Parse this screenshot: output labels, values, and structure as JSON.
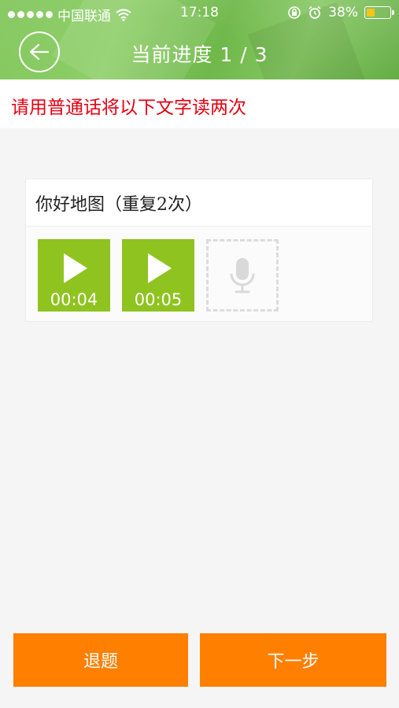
{
  "status_bar": {
    "carrier": "中国联通",
    "time": "17:18",
    "battery": "38%",
    "battery_level": 0.38
  },
  "header": {
    "back_icon": "back-arrow-icon",
    "title": "当前进度  1 / 3"
  },
  "instruction": "请用普通话将以下文字读两次",
  "card": {
    "prompt": "你好地图（重复2次）",
    "recordings": [
      {
        "duration": "00:04"
      },
      {
        "duration": "00:05"
      }
    ],
    "record_icon": "microphone-icon"
  },
  "buttons": {
    "quit": "退题",
    "next": "下一步"
  },
  "colors": {
    "accent_orange": "#ff7f00",
    "clip_green": "#8fc31f",
    "instruction_red": "#e60012"
  }
}
